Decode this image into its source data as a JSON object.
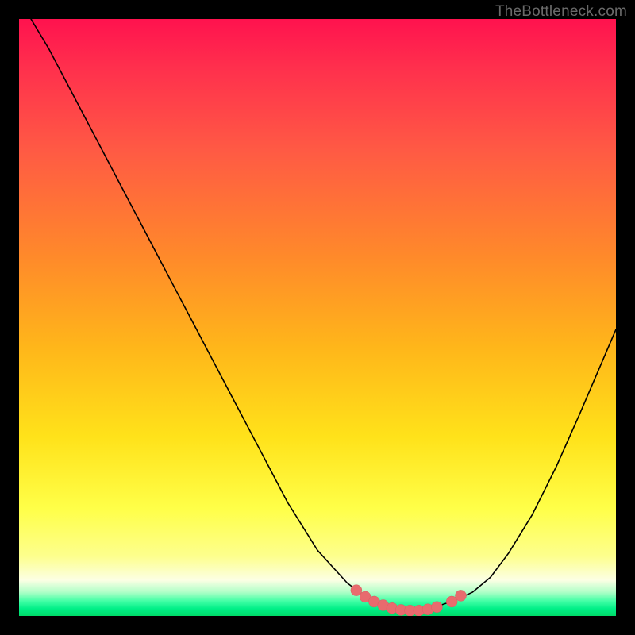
{
  "watermark": "TheBottleneck.com",
  "colors": {
    "curve_stroke": "#000000",
    "marker_fill": "#e86b6e",
    "marker_stroke": "#d75e61"
  },
  "chart_data": {
    "type": "line",
    "title": "",
    "xlabel": "",
    "ylabel": "",
    "xlim": [
      0,
      100
    ],
    "ylim": [
      0,
      100
    ],
    "grid": false,
    "legend": false,
    "series": [
      {
        "name": "bottleneck-curve-left",
        "x": [
          2,
          5,
          10,
          15,
          20,
          25,
          30,
          35,
          40,
          45,
          50,
          55,
          57,
          60,
          62,
          64
        ],
        "values": [
          100,
          95,
          85.5,
          76,
          66.5,
          57,
          47.5,
          38,
          28.5,
          19,
          11,
          5.5,
          4.0,
          2.3,
          1.4,
          0.8
        ]
      },
      {
        "name": "bottleneck-curve-right",
        "x": [
          64,
          67,
          70,
          73,
          76,
          79,
          82,
          86,
          90,
          94,
          97,
          100
        ],
        "values": [
          0.8,
          1.0,
          1.6,
          2.6,
          4.0,
          6.5,
          10.5,
          17,
          25,
          34,
          41,
          48
        ]
      }
    ],
    "markers": {
      "name": "highlighted-range",
      "points": [
        {
          "x": 56.5,
          "y": 4.3
        },
        {
          "x": 58.0,
          "y": 3.2
        },
        {
          "x": 59.5,
          "y": 2.4
        },
        {
          "x": 61.0,
          "y": 1.8
        },
        {
          "x": 62.5,
          "y": 1.3
        },
        {
          "x": 64.0,
          "y": 1.0
        },
        {
          "x": 65.5,
          "y": 0.9
        },
        {
          "x": 67.0,
          "y": 0.9
        },
        {
          "x": 68.5,
          "y": 1.1
        },
        {
          "x": 70.0,
          "y": 1.5
        },
        {
          "x": 72.5,
          "y": 2.4
        },
        {
          "x": 74.0,
          "y": 3.4
        }
      ],
      "radius": 7
    }
  }
}
